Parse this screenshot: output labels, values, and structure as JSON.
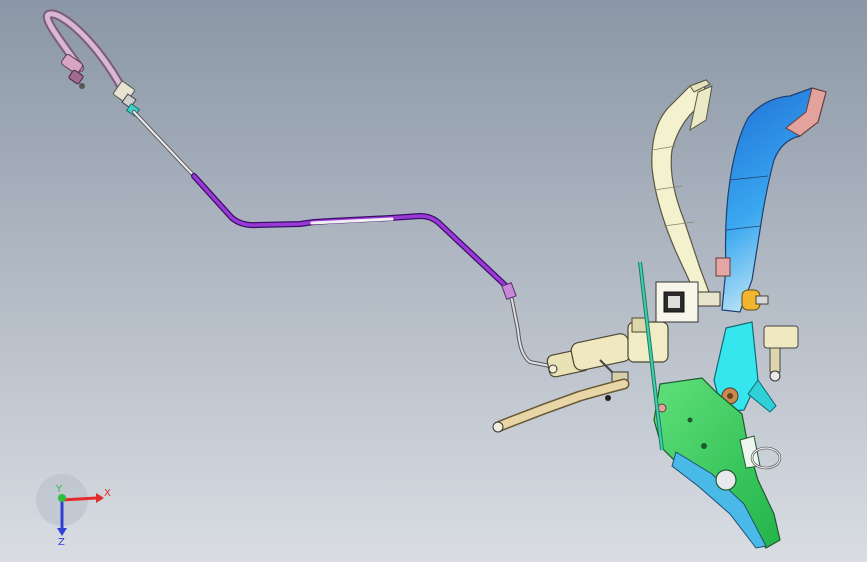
{
  "viewport": {
    "background_top": "#8b97a6",
    "background_bottom": "#d9dde3"
  },
  "triad": {
    "x_label": "X",
    "y_label": "Y",
    "z_label": "Z",
    "x_color": "#e32b2b",
    "y_color": "#2fbf3a",
    "z_color": "#2f3fd6"
  },
  "colors": {
    "brake_pedal": "#2f8fe6",
    "clutch_pedal": "#f4f1cf",
    "bracket": "#43d86b",
    "pipe_purple": "#9a38d8",
    "hose_pink": "#c9a6c9",
    "cylinder": "#e9e2b6",
    "cyan_part": "#35e6ee"
  }
}
